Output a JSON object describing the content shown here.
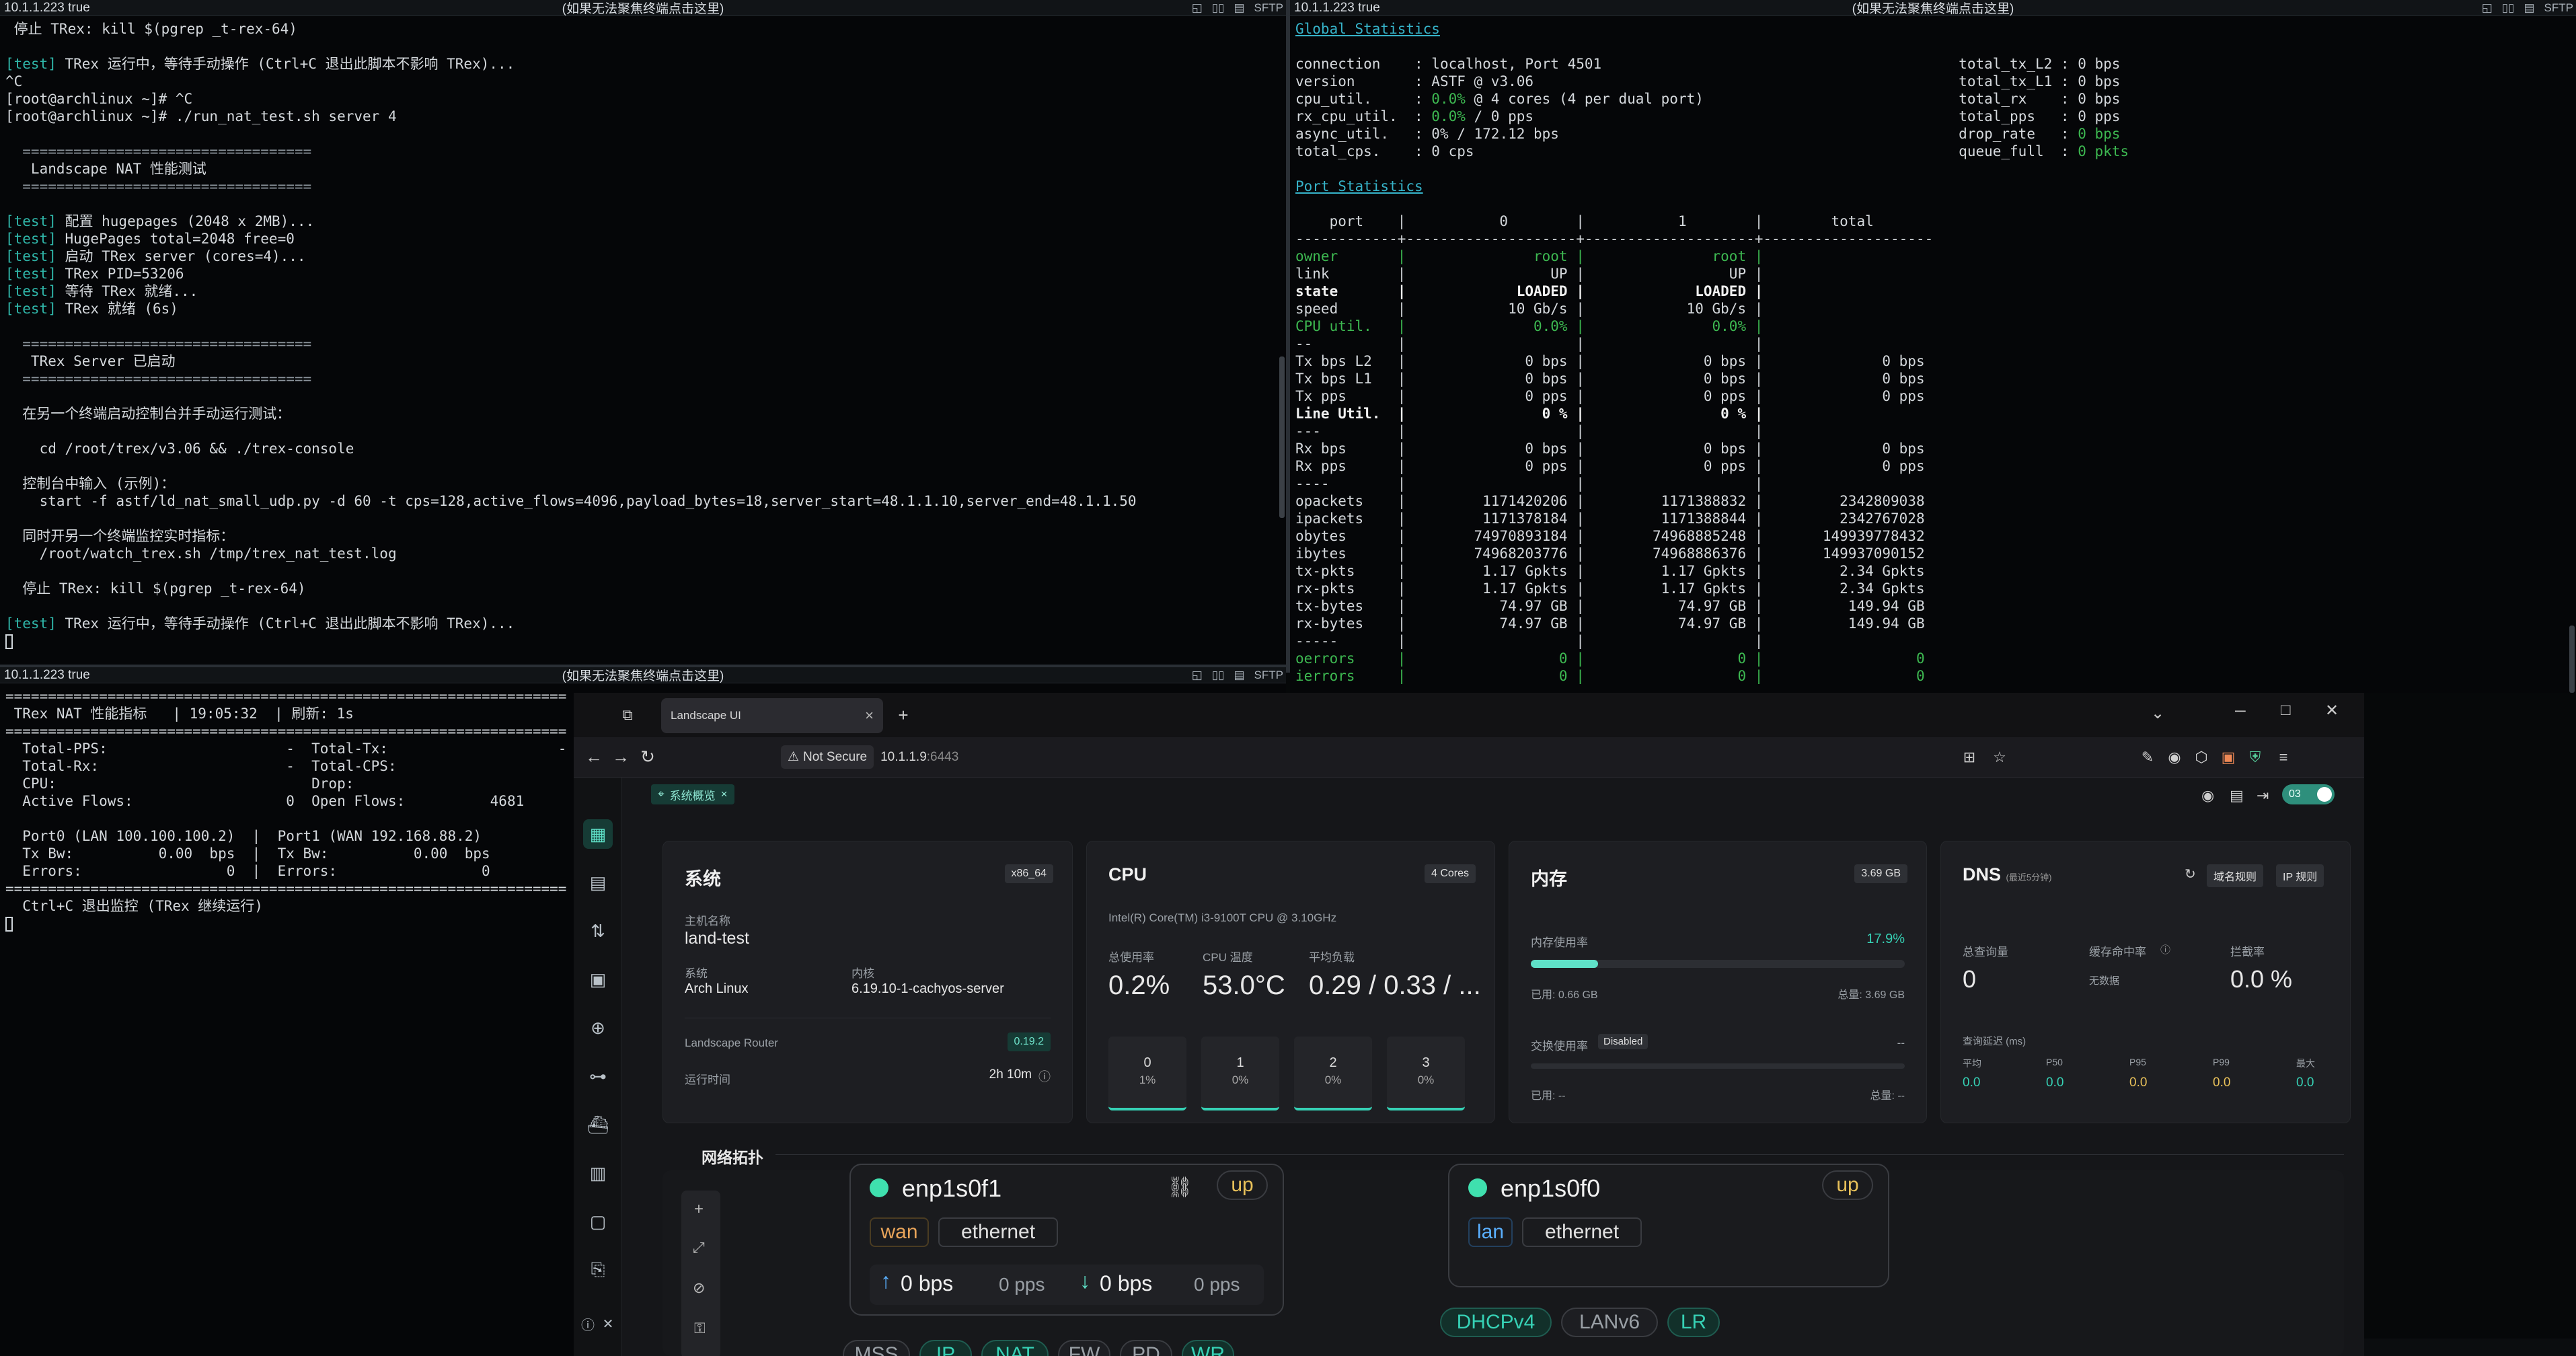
{
  "terminal_top_left": {
    "title_left": "10.1.1.223 true",
    "title_center": "(如果无法聚焦终端点击这里)",
    "title_right_icons": [
      "◱",
      "▯▯",
      "▤"
    ],
    "sftp": "SFTP",
    "lines": [
      " 停止 TRex: kill $(pgrep _t-rex-64)",
      "",
      "[test] TRex 运行中，等待手动操作 (Ctrl+C 退出此脚本不影响 TRex)...",
      "^C",
      "[root@archlinux ~]# ^C",
      "[root@archlinux ~]# ./run_nat_test.sh server 4",
      "",
      "  ==================================",
      "   Landscape NAT 性能测试",
      "  ==================================",
      "",
      "[test] 配置 hugepages (2048 x 2MB)...",
      "[test] HugePages total=2048 free=0",
      "[test] 启动 TRex server (cores=4)...",
      "[test] TRex PID=53206",
      "[test] 等待 TRex 就绪...",
      "[test] TRex 就绪 (6s)",
      "",
      "  ==================================",
      "   TRex Server 已启动",
      "  ==================================",
      "",
      "  在另一个终端启动控制台并手动运行测试：",
      "",
      "    cd /root/trex/v3.06 && ./trex-console",
      "",
      "  控制台中输入 (示例)：",
      "    start -f astf/ld_nat_small_udp.py -d 60 -t cps=128,active_flows=4096,payload_bytes=18,server_start=48.1.1.10,server_end=48.1.1.50",
      "",
      "  同时开另一个终端监控实时指标：",
      "    /root/watch_trex.sh /tmp/trex_nat_test.log",
      "",
      "  停止 TRex: kill $(pgrep _t-rex-64)",
      "",
      "[test] TRex 运行中，等待手动操作 (Ctrl+C 退出此脚本不影响 TRex)..."
    ]
  },
  "terminal_top_right": {
    "title_left": "10.1.1.223 true",
    "title_center": "(如果无法聚焦终端点击这里)",
    "sftp": "SFTP",
    "global_stats_label": "Global Statistics",
    "port_stats_label": "Port Statistics",
    "global_left": [
      [
        "connection",
        "localhost, Port 4501"
      ],
      [
        "version",
        "ASTF @ v3.06"
      ],
      [
        "cpu_util.",
        "0.0% @ 4 cores (4 per dual port)"
      ],
      [
        "rx_cpu_util.",
        "0.0% / 0 pps"
      ],
      [
        "async_util.",
        "0% / 172.12 bps"
      ],
      [
        "total_cps.",
        "0 cps"
      ]
    ],
    "global_right": [
      [
        "total_tx_L2",
        "0 bps"
      ],
      [
        "total_tx_L1",
        "0 bps"
      ],
      [
        "total_rx",
        "0 bps"
      ],
      [
        "total_pps",
        "0 pps"
      ],
      [
        "drop_rate",
        "0 bps"
      ],
      [
        "queue_full",
        "0 pkts"
      ]
    ],
    "port_header": [
      "port",
      "0",
      "1",
      "total"
    ],
    "port_rows": [
      [
        "sep",
        "",
        "",
        ""
      ],
      [
        "owner",
        "root",
        "root",
        ""
      ],
      [
        "link",
        "UP",
        "UP",
        ""
      ],
      [
        "state",
        "LOADED",
        "LOADED",
        ""
      ],
      [
        "speed",
        "10 Gb/s",
        "10 Gb/s",
        ""
      ],
      [
        "CPU util.",
        "0.0%",
        "0.0%",
        ""
      ],
      [
        "--",
        "",
        "",
        ""
      ],
      [
        "Tx bps L2",
        "0 bps",
        "0 bps",
        "0 bps"
      ],
      [
        "Tx bps L1",
        "0 bps",
        "0 bps",
        "0 bps"
      ],
      [
        "Tx pps",
        "0 pps",
        "0 pps",
        "0 pps"
      ],
      [
        "Line Util.",
        "0 %",
        "0 %",
        ""
      ],
      [
        "---",
        "",
        "",
        ""
      ],
      [
        "Rx bps",
        "0 bps",
        "0 bps",
        "0 bps"
      ],
      [
        "Rx pps",
        "0 pps",
        "0 pps",
        "0 pps"
      ],
      [
        "----",
        "",
        "",
        ""
      ],
      [
        "opackets",
        "1171420206",
        "1171388832",
        "2342809038"
      ],
      [
        "ipackets",
        "1171378184",
        "1171388844",
        "2342767028"
      ],
      [
        "obytes",
        "74970893184",
        "74968885248",
        "149939778432"
      ],
      [
        "ibytes",
        "74968203776",
        "74968886376",
        "149937090152"
      ],
      [
        "tx-pkts",
        "1.17 Gpkts",
        "1.17 Gpkts",
        "2.34 Gpkts"
      ],
      [
        "rx-pkts",
        "1.17 Gpkts",
        "1.17 Gpkts",
        "2.34 Gpkts"
      ],
      [
        "tx-bytes",
        "74.97 GB",
        "74.97 GB",
        "149.94 GB"
      ],
      [
        "rx-bytes",
        "74.97 GB",
        "74.97 GB",
        "149.94 GB"
      ],
      [
        "-----",
        "",
        "",
        ""
      ],
      [
        "oerrors",
        "0",
        "0",
        "0"
      ],
      [
        "ierrors",
        "0",
        "0",
        "0"
      ]
    ]
  },
  "terminal_bottom_left": {
    "title_left": "10.1.1.223 true",
    "title_center": "(如果无法聚焦终端点击这里)",
    "sftp": "SFTP",
    "lines": [
      "==================================================================",
      " TRex NAT 性能指标   | 19:05:32  | 刷新: 1s",
      "==================================================================",
      "  Total-PPS:                     -  Total-Tx:                    -",
      "  Total-Rx:                      -  Total-CPS:",
      "  CPU:                              Drop:",
      "  Active Flows:                  0  Open Flows:          4681",
      "",
      "  Port0 (LAN 100.100.100.2)  |  Port1 (WAN 192.168.88.2)",
      "  Tx Bw:          0.00  bps  |  Tx Bw:          0.00  bps",
      "  Errors:                 0  |  Errors:                 0",
      "==================================================================",
      "  Ctrl+C 退出监控 (TRex 继续运行)"
    ]
  },
  "browser": {
    "tab_title": "Landscape UI",
    "new_tab": "+",
    "not_secure": "Not Secure",
    "url_host": "10.1.1.9",
    "url_port": ":6443",
    "window_controls": [
      "⌄",
      "─",
      "□",
      "✕"
    ],
    "breadcrumb": "系统概览",
    "toggle_label": "03",
    "system": {
      "title": "系统",
      "arch": "x86_64",
      "host_label": "主机名称",
      "host": "land-test",
      "os_label": "系统",
      "os": "Arch Linux",
      "kernel_label": "内核",
      "kernel": "6.19.10-1-cachyos-server",
      "router_label": "Landscape Router",
      "router_version": "0.19.2",
      "uptime_label": "运行时间",
      "uptime": "2h 10m"
    },
    "cpu": {
      "title": "CPU",
      "cores": "4 Cores",
      "model": "Intel(R) Core(TM) i3-9100T CPU @ 3.10GHz",
      "usage_label": "总使用率",
      "usage": "0.2%",
      "temp_label": "CPU 温度",
      "temp": "53.0°C",
      "load_label": "平均负载",
      "load": "0.29 / 0.33 / ...",
      "core_list": [
        {
          "id": "0",
          "pct": "1%"
        },
        {
          "id": "1",
          "pct": "0%"
        },
        {
          "id": "2",
          "pct": "0%"
        },
        {
          "id": "3",
          "pct": "0%"
        }
      ]
    },
    "memory": {
      "title": "内存",
      "total_badge": "3.69 GB",
      "usage_label": "内存使用率",
      "usage": "17.9%",
      "usage_fraction": 0.179,
      "used": "已用: 0.66 GB",
      "total": "总量: 3.69 GB",
      "swap_label": "交换使用率",
      "swap_state": "Disabled",
      "swap_value": "--",
      "swap_used": "已用: --",
      "swap_total": "总量: --"
    },
    "dns": {
      "title": "DNS",
      "title_sub": "(最近5分钟)",
      "btn_domain": "域名规则",
      "btn_ip": "IP 规则",
      "queries_label": "总查询量",
      "queries": "0",
      "hit_label": "缓存命中率",
      "hit": "无数据",
      "block_label": "拦截率",
      "block": "0.0 %",
      "latency_label": "查询延迟 (ms)",
      "latency_cols": [
        {
          "label": "平均",
          "value": "0.0"
        },
        {
          "label": "P50",
          "value": "0.0"
        },
        {
          "label": "P95",
          "value": "0.0"
        },
        {
          "label": "P99",
          "value": "0.0"
        },
        {
          "label": "最大",
          "value": "0.0"
        }
      ]
    },
    "topology": {
      "title": "网络拓扑",
      "iface1": {
        "name": "enp1s0f1",
        "state": "up",
        "role": "wan",
        "type": "ethernet",
        "up": "0 bps",
        "up_pps": "0 pps",
        "down": "0 bps",
        "down_pps": "0 pps",
        "chips": [
          "MSS",
          "IP",
          "NAT",
          "FW",
          "PD",
          "WR"
        ]
      },
      "iface2": {
        "name": "enp1s0f0",
        "state": "up",
        "role": "lan",
        "type": "ethernet",
        "chips": [
          "DHCPv4",
          "LANv6",
          "LR"
        ]
      }
    }
  }
}
